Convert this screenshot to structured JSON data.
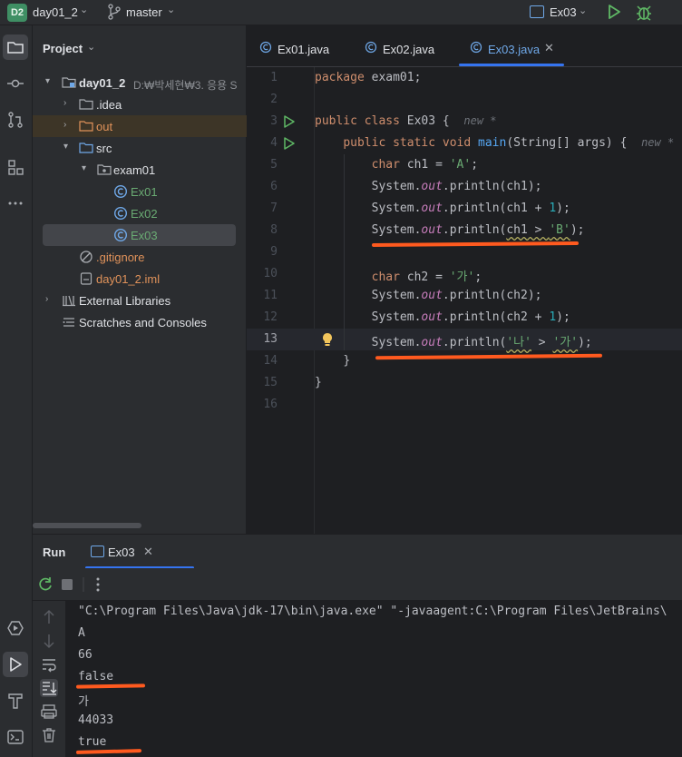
{
  "titlebar": {
    "project_badge": "D2",
    "project_name": "day01_2",
    "branch": "master",
    "run_config": "Ex03",
    "colors": {
      "badge": "#3f8f64",
      "run": "#5fb865",
      "debug": "#5fb865"
    }
  },
  "left_stripe": {
    "icons": [
      "folder-icon",
      "commit-icon",
      "pull-requests-icon",
      "structure-icon",
      "more-icon",
      "services-icon",
      "run-icon",
      "build-icon",
      "terminal-icon"
    ]
  },
  "project": {
    "title": "Project",
    "tree": [
      {
        "label": "day01_2",
        "hint": "D:₩박세현₩3. 응용 S",
        "icon": "module-folder-icon"
      },
      {
        "label": ".idea",
        "icon": "folder-icon"
      },
      {
        "label": "out",
        "icon": "folder-icon"
      },
      {
        "label": "src",
        "icon": "source-folder-icon"
      },
      {
        "label": "exam01",
        "icon": "package-icon"
      },
      {
        "label": "Ex01",
        "icon": "java-class-icon"
      },
      {
        "label": "Ex02",
        "icon": "java-class-icon"
      },
      {
        "label": "Ex03",
        "icon": "java-class-icon"
      },
      {
        "label": ".gitignore",
        "icon": "ignore-file-icon"
      },
      {
        "label": "day01_2.iml",
        "icon": "iml-file-icon"
      },
      {
        "label": "External Libraries",
        "icon": "libraries-icon"
      },
      {
        "label": "Scratches and Consoles",
        "icon": "scratches-icon"
      }
    ]
  },
  "editor": {
    "tabs": [
      {
        "label": "Ex01.java"
      },
      {
        "label": "Ex02.java"
      },
      {
        "label": "Ex03.java",
        "close": "✕"
      }
    ],
    "current_line": 13,
    "line_numbers": [
      "1",
      "2",
      "3",
      "4",
      "5",
      "6",
      "7",
      "8",
      "9",
      "10",
      "11",
      "12",
      "13",
      "14",
      "15",
      "16"
    ],
    "code": {
      "l1": {
        "kw": "package",
        "rest": " exam01;"
      },
      "l3": {
        "kw": "public class",
        "name": " Ex03 {",
        "hint": "new *"
      },
      "l4": {
        "kw1": "public static void",
        "fn": "main",
        "rest": "(String[] args) {",
        "hint": "new *"
      },
      "l5": {
        "kw": "char",
        "rest": " ch1 = ",
        "lit": "'A'",
        "end": ";"
      },
      "l6": {
        "pre": "System.",
        "fld": "out",
        "rest": ".println(ch1);"
      },
      "l7": {
        "pre": "System.",
        "fld": "out",
        "rest": ".println(ch1 + ",
        "num": "1",
        "end": ");"
      },
      "l8": {
        "pre": "System.",
        "fld": "out",
        "mid": ".println(",
        "warn": "ch1 > ",
        "lit": "'B'",
        "end": ");"
      },
      "l10": {
        "kw": "char",
        "rest": " ch2 = ",
        "lit": "'가'",
        "end": ";"
      },
      "l11": {
        "pre": "System.",
        "fld": "out",
        "rest": ".println(ch2);"
      },
      "l12": {
        "pre": "System.",
        "fld": "out",
        "rest": ".println(ch2 + ",
        "num": "1",
        "end": ");"
      },
      "l13": {
        "pre": "System.",
        "fld": "out",
        "mid": ".println(",
        "lit1": "'나'",
        "op": " > ",
        "lit2": "'가'",
        "end": ");"
      },
      "l14": "}",
      "l15": "}"
    }
  },
  "run": {
    "title": "Run",
    "tab_label": "Ex03",
    "tab_close": "✕",
    "output": [
      "\"C:\\Program Files\\Java\\jdk-17\\bin\\java.exe\" \"-javaagent:C:\\Program Files\\JetBrains\\",
      "A",
      "66",
      "false",
      "가",
      "44033",
      "true"
    ]
  },
  "annotation_color": "#ff5a1f"
}
